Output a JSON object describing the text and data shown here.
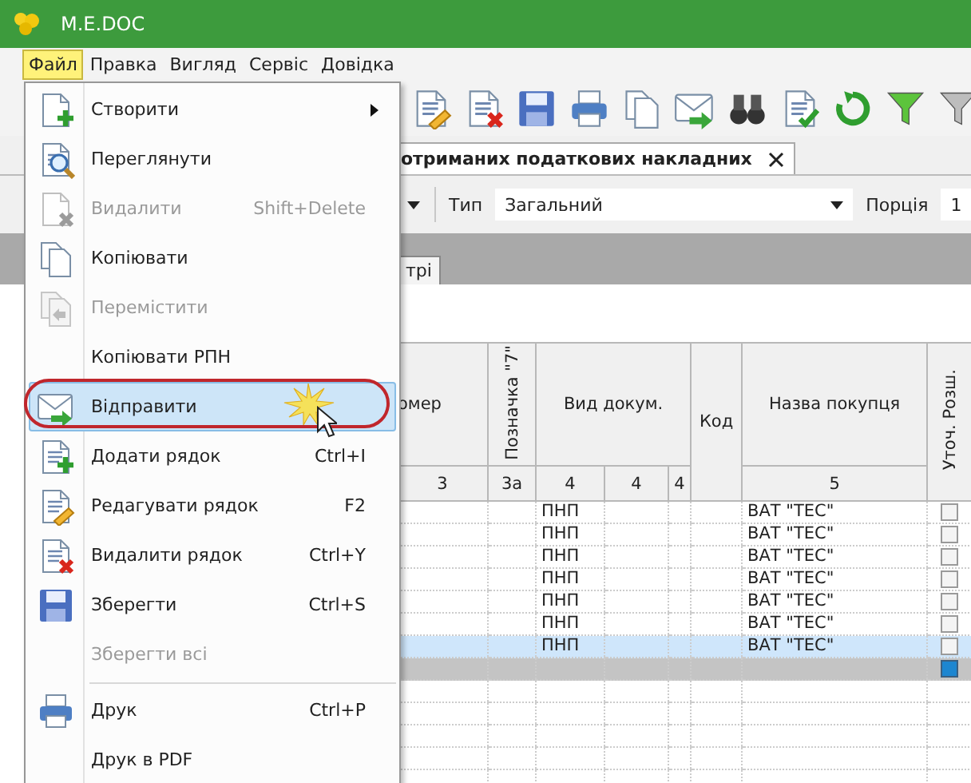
{
  "window": {
    "title": "M.E.DOC"
  },
  "menu_bar": [
    {
      "label": "Файл",
      "selected": true
    },
    {
      "label": "Правка",
      "selected": false
    },
    {
      "label": "Вигляд",
      "selected": false
    },
    {
      "label": "Сервіс",
      "selected": false
    },
    {
      "label": "Довідка",
      "selected": false
    }
  ],
  "document_tab": {
    "title": "отриманих податкових накладних"
  },
  "filters": {
    "type_label": "Тип",
    "type_value": "Загальний",
    "portion_label": "Порція",
    "portion_value": "1"
  },
  "view_tab": {
    "label": "трі"
  },
  "table": {
    "columns": [
      "омер",
      "Позначка \"7\"",
      "Вид докум.",
      "Код",
      "Назва покупця",
      "Уточ. Розш."
    ],
    "column_numbers": [
      "3",
      "3а",
      "4",
      "4",
      "4",
      "5"
    ],
    "rows": [
      {
        "kind": "data",
        "doc_type": "ПНП",
        "buyer": "ВАТ \"ТЕС\"",
        "checked": false,
        "selected": false
      },
      {
        "kind": "data",
        "doc_type": "ПНП",
        "buyer": "ВАТ \"ТЕС\"",
        "checked": false,
        "selected": false
      },
      {
        "kind": "data",
        "doc_type": "ПНП",
        "buyer": "ВАТ \"ТЕС\"",
        "checked": false,
        "selected": false
      },
      {
        "kind": "data",
        "doc_type": "ПНП",
        "buyer": "ВАТ \"ТЕС\"",
        "checked": false,
        "selected": false
      },
      {
        "kind": "data",
        "doc_type": "ПНП",
        "buyer": "ВАТ \"ТЕС\"",
        "checked": false,
        "selected": false
      },
      {
        "kind": "data",
        "doc_type": "ПНП",
        "buyer": "ВАТ \"ТЕС\"",
        "checked": false,
        "selected": false
      },
      {
        "kind": "data",
        "doc_type": "ПНП",
        "buyer": "ВАТ \"ТЕС\"",
        "checked": false,
        "selected": true
      },
      {
        "kind": "new",
        "checked": true,
        "selected": false
      }
    ]
  },
  "file_menu": {
    "items": [
      {
        "label": "Створити",
        "disabled": false,
        "selected": false,
        "submenu": true
      },
      {
        "label": "Переглянути",
        "disabled": false,
        "selected": false
      },
      {
        "label": "Видалити",
        "shortcut": "Shift+Delete",
        "disabled": true,
        "selected": false
      },
      {
        "label": "Копіювати",
        "disabled": false,
        "selected": false
      },
      {
        "label": "Перемістити",
        "disabled": true,
        "selected": false
      },
      {
        "label": "Копіювати РПН",
        "disabled": false,
        "selected": false
      },
      {
        "label": "Відправити",
        "disabled": false,
        "selected": true
      },
      {
        "label": "Додати рядок",
        "shortcut": "Ctrl+I",
        "disabled": false,
        "selected": false
      },
      {
        "label": "Редагувати рядок",
        "shortcut": "F2",
        "disabled": false,
        "selected": false
      },
      {
        "label": "Видалити рядок",
        "shortcut": "Ctrl+Y",
        "disabled": false,
        "selected": false
      },
      {
        "label": "Зберегти",
        "shortcut": "Ctrl+S",
        "disabled": false,
        "selected": false
      },
      {
        "label": "Зберегти всі",
        "disabled": true,
        "selected": false
      },
      {
        "label": "Друк",
        "shortcut": "Ctrl+P",
        "disabled": false,
        "selected": false,
        "separator_before": true
      },
      {
        "label": "Друк в PDF",
        "disabled": false,
        "selected": false
      }
    ]
  }
}
